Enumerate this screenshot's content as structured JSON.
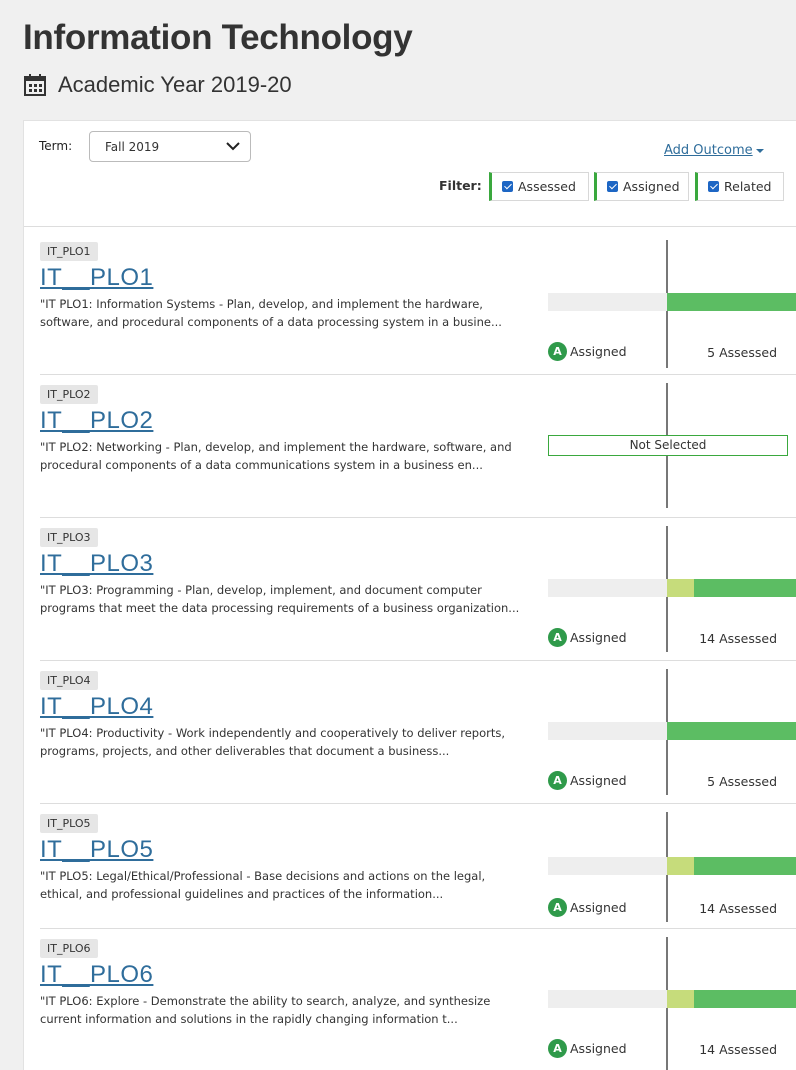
{
  "header": {
    "title": "Information Technology",
    "academic_year": "Academic Year 2019-20"
  },
  "controls": {
    "term_label": "Term:",
    "term_value": "Fall 2019",
    "add_outcome_label": "Add Outcome",
    "filter_label": "Filter:",
    "filters": [
      {
        "label": "Assessed",
        "checked": true
      },
      {
        "label": "Assigned",
        "checked": true
      },
      {
        "label": "Related",
        "checked": true
      }
    ]
  },
  "colors": {
    "accent_green": "#3aa83e",
    "bar_green": "#5cbd63",
    "bar_light_green": "#c6dc7b",
    "link_blue": "#2f6d9b"
  },
  "outcomes": [
    {
      "tag": "IT_PLO1",
      "code": "IT__PLO1",
      "description": "\"IT PLO1: Information Systems - Plan, develop, and implement the hardware, software, and procedural components of a data processing system in a busine...",
      "status": "Assigned",
      "badge": "A",
      "assessed": "5 Assessed",
      "selected": true,
      "partial_fraction": 0,
      "fill_fraction": 1
    },
    {
      "tag": "IT_PLO2",
      "code": "IT__PLO2",
      "description": "\"IT PLO2: Networking - Plan, develop, and implement the hardware, software, and procedural components of a data communications system in a business en...",
      "status": "",
      "badge": "",
      "assessed": "",
      "selected": false,
      "not_selected_label": "Not Selected"
    },
    {
      "tag": "IT_PLO3",
      "code": "IT__PLO3",
      "description": "\"IT PLO3: Programming - Plan, develop, implement, and document computer programs that meet the data processing requirements of a business organization...",
      "status": "Assigned",
      "badge": "A",
      "assessed": "14 Assessed",
      "selected": true,
      "partial_fraction": 0.21,
      "fill_fraction": 1
    },
    {
      "tag": "IT_PLO4",
      "code": "IT__PLO4",
      "description": "\"IT PLO4: Productivity - Work independently and cooperatively to deliver reports, programs, projects, and other deliverables that document a business...",
      "status": "Assigned",
      "badge": "A",
      "assessed": "5 Assessed",
      "selected": true,
      "partial_fraction": 0,
      "fill_fraction": 1
    },
    {
      "tag": "IT_PLO5",
      "code": "IT__PLO5",
      "description": "\"IT PLO5: Legal/Ethical/Professional - Base decisions and actions on the legal, ethical, and professional guidelines and practices of the information...",
      "status": "Assigned",
      "badge": "A",
      "assessed": "14 Assessed",
      "selected": true,
      "partial_fraction": 0.21,
      "fill_fraction": 1
    },
    {
      "tag": "IT_PLO6",
      "code": "IT__PLO6",
      "description": "\"IT PLO6: Explore - Demonstrate the ability to search, analyze, and synthesize current information and solutions in the rapidly changing information t...",
      "status": "Assigned",
      "badge": "A",
      "assessed": "14 Assessed",
      "selected": true,
      "partial_fraction": 0.21,
      "fill_fraction": 1
    }
  ]
}
